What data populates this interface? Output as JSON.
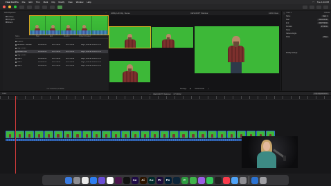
{
  "menubar": {
    "app_name": "Final Cut Pro",
    "items": [
      "File",
      "Edit",
      "Trim",
      "Mark",
      "Clip",
      "Modify",
      "View",
      "Window",
      "Help"
    ],
    "time": "Tue 1:24 PM"
  },
  "browser": {
    "header_left": "Hide Rejected",
    "sidebar": [
      "Library",
      "Projects",
      "Event"
    ],
    "columns": [
      "Name",
      "Start",
      "End",
      "Duration",
      "Content Created"
    ],
    "rows": [
      {
        "name": "Projects",
        "start": "",
        "end": "",
        "duration": "",
        "created": ""
      },
      {
        "name": "DESCRIPT Webinar",
        "start": "00:00:00:00",
        "end": "00:07:38:02",
        "duration": "00:07:38:02",
        "created": "Aug 8, 2023 at 12:30:37 PM"
      },
      {
        "name": "Aug 8, 2023",
        "start": "",
        "end": "",
        "duration": "",
        "created": ""
      },
      {
        "name": "Multicam Clip",
        "start": "00:00:00:00",
        "end": "00:07:38:02",
        "duration": "00:07:38:02",
        "created": "Aug 8, 2023 at 12:30:37 PM"
      },
      {
        "name": "Aug 8, 2023",
        "start": "",
        "end": "",
        "duration": "",
        "created": ""
      },
      {
        "name": "Cam 1",
        "start": "00:00:00:00",
        "end": "00:07:38:02",
        "duration": "00:07:38:02",
        "created": "Aug 8, 2023 at 12:30:37 PM"
      },
      {
        "name": "Cam 2",
        "start": "00:00:00:00",
        "end": "00:07:38:02",
        "duration": "00:07:38:02",
        "created": "Aug 8, 2023 at 12:30:37 PM"
      },
      {
        "name": "Cam 3",
        "start": "00:00:00:00",
        "end": "00:07:38:02",
        "duration": "00:07:38:02",
        "created": "Aug 8, 2023 at 12:30:37 PM"
      }
    ],
    "footer": "1 of 4 selected, 07:38:02"
  },
  "viewer": {
    "header_left": "1080p HD 30p, Stereo",
    "header_center": "DESCRIPT Webinar",
    "zoom": "100%",
    "view_label": "View",
    "angle_label": "Settings",
    "timecode": "00:00:00:00"
  },
  "inspector": {
    "title": "Cam 1",
    "duration": "7:38:02",
    "rows": [
      {
        "label": "Name",
        "value": "Cam 1"
      },
      {
        "label": "Start",
        "value": "00:00:00:00"
      },
      {
        "label": "End",
        "value": "00:07:38:02"
      },
      {
        "label": "Duration",
        "value": "07:38:02"
      },
      {
        "label": "Notes",
        "value": ""
      },
      {
        "label": "Camera Angle",
        "value": ""
      },
      {
        "label": "Roles",
        "value": "Video"
      }
    ],
    "footer": "Modify Settings"
  },
  "timeline": {
    "index_label": "Index",
    "project_name": "DESCRIPT Webinar",
    "duration": "07:38:02",
    "right_button": "Clip Appearance"
  },
  "dock": {
    "icons": [
      {
        "name": "finder-icon",
        "label": "",
        "color": "#3a7be0"
      },
      {
        "name": "launchpad-icon",
        "label": "",
        "color": "#8e8e93"
      },
      {
        "name": "chrome-icon",
        "label": "",
        "color": "#e9e9e9"
      },
      {
        "name": "safari-icon",
        "label": "",
        "color": "#2f7ff0"
      },
      {
        "name": "imovie-icon",
        "label": "",
        "color": "#6b4ed6"
      },
      {
        "name": "photos-icon",
        "label": "",
        "color": "#ffffff"
      },
      {
        "name": "slack-icon",
        "label": "",
        "color": "#4a154b"
      },
      {
        "name": "final-cut-icon",
        "label": "",
        "color": "#111111"
      },
      {
        "name": "after-effects-icon",
        "label": "Ae",
        "color": "#1d0a45"
      },
      {
        "name": "illustrator-icon",
        "label": "Ai",
        "color": "#2b1400"
      },
      {
        "name": "audition-icon",
        "label": "Au",
        "color": "#002a2a"
      },
      {
        "name": "premiere-icon",
        "label": "Pr",
        "color": "#1a0a3a"
      },
      {
        "name": "photoshop-icon",
        "label": "Ps",
        "color": "#001e36"
      },
      {
        "name": "lightroom-icon",
        "label": "",
        "color": "#0c2438"
      },
      {
        "name": "camtasia-icon",
        "label": "C",
        "color": "#2f9c41"
      },
      {
        "name": "descript-icon",
        "label": "",
        "color": "#3fb34a"
      },
      {
        "name": "figma-icon",
        "label": "",
        "color": "#9b5de5"
      },
      {
        "name": "messages-icon",
        "label": "",
        "color": "#34c759"
      },
      {
        "name": "obs-icon",
        "label": "",
        "color": "#202020"
      },
      {
        "name": "music-icon",
        "label": "",
        "color": "#fa3c4c"
      },
      {
        "name": "preview-icon",
        "label": "",
        "color": "#4fa3f7"
      },
      {
        "name": "settings-icon",
        "label": "",
        "color": "#8e8e93"
      },
      {
        "name": "folder-icon",
        "label": "",
        "color": "#2c73d2"
      },
      {
        "name": "trash-icon",
        "label": "",
        "color": "#a0a0a4"
      }
    ]
  },
  "colors": {
    "green_screen": "#3db838",
    "selection_yellow": "#d8b623",
    "playhead": "#d23b3b",
    "clip_border": "#2c6fc9"
  }
}
